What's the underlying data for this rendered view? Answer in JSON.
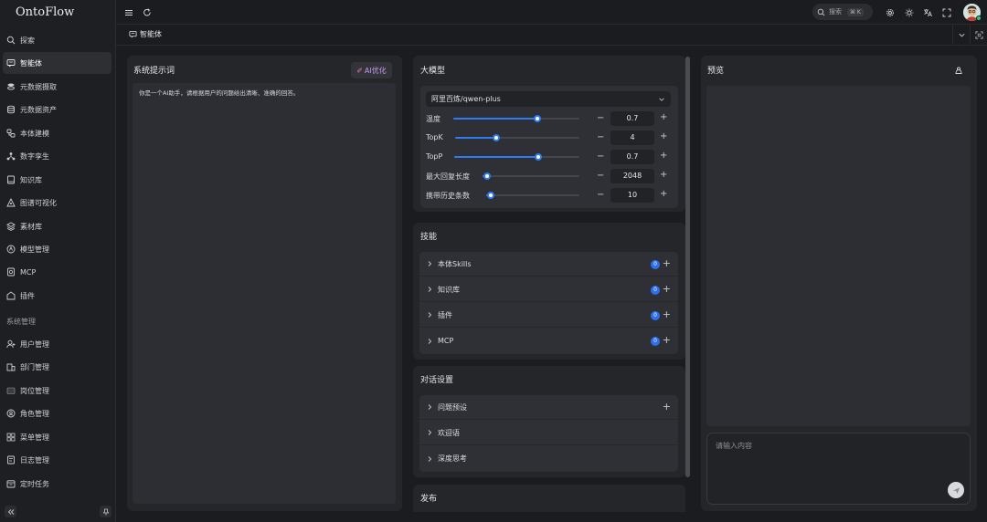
{
  "app": {
    "title": "OntoFlow"
  },
  "sidebar": {
    "items": [
      {
        "label": "探索",
        "icon": "search-icon"
      },
      {
        "label": "智能体",
        "icon": "agent-icon",
        "active": true
      },
      {
        "label": "元数据摄取",
        "icon": "ingest-icon"
      },
      {
        "label": "元数据资产",
        "icon": "database-icon"
      },
      {
        "label": "本体建模",
        "icon": "modeling-icon"
      },
      {
        "label": "数字孪生",
        "icon": "network-icon"
      },
      {
        "label": "知识库",
        "icon": "book-icon"
      },
      {
        "label": "图谱可视化",
        "icon": "graph-icon"
      },
      {
        "label": "素材库",
        "icon": "layers-icon"
      },
      {
        "label": "模型管理",
        "icon": "model-icon"
      },
      {
        "label": "MCP",
        "icon": "mcp-icon"
      },
      {
        "label": "插件",
        "icon": "plugin-icon"
      }
    ],
    "section_label": "系统管理",
    "system_items": [
      {
        "label": "用户管理",
        "icon": "user-icon"
      },
      {
        "label": "部门管理",
        "icon": "building-icon"
      },
      {
        "label": "岗位管理",
        "icon": "position-icon"
      },
      {
        "label": "角色管理",
        "icon": "role-icon"
      },
      {
        "label": "菜单管理",
        "icon": "menu-grid-icon"
      },
      {
        "label": "日志管理",
        "icon": "log-icon"
      },
      {
        "label": "定时任务",
        "icon": "calendar-icon"
      }
    ]
  },
  "header": {
    "search_placeholder": "搜索",
    "search_shortcut": "⌘ K"
  },
  "tab": {
    "label": "智能体"
  },
  "prompt_panel": {
    "title": "系统提示词",
    "ai_button": "AI优化",
    "content": "你是一个AI助手，请根据用户的问题给出清晰、准确的回答。"
  },
  "model_panel": {
    "title": "大模型",
    "model": "阿里百炼/qwen-plus",
    "params": [
      {
        "label": "温度",
        "value": "0.7",
        "fraction": 0.67
      },
      {
        "label": "TopK",
        "value": "4",
        "fraction": 0.33
      },
      {
        "label": "TopP",
        "value": "0.7",
        "fraction": 0.67
      },
      {
        "label": "最大回复长度",
        "value": "2048",
        "fraction": 0.05
      },
      {
        "label": "携带历史条数",
        "value": "10",
        "fraction": 0.05
      }
    ]
  },
  "skills_panel": {
    "title": "技能",
    "rows": [
      {
        "label": "本体Skills",
        "count": "0"
      },
      {
        "label": "知识库",
        "count": "0"
      },
      {
        "label": "插件",
        "count": "0"
      },
      {
        "label": "MCP",
        "count": "0"
      }
    ]
  },
  "dialog_panel": {
    "title": "对话设置",
    "rows": [
      {
        "label": "问题预设"
      },
      {
        "label": "欢迎语"
      },
      {
        "label": "深度思考"
      }
    ]
  },
  "publish_panel": {
    "title": "发布"
  },
  "preview_panel": {
    "title": "预览",
    "input_placeholder": "请输入内容"
  }
}
